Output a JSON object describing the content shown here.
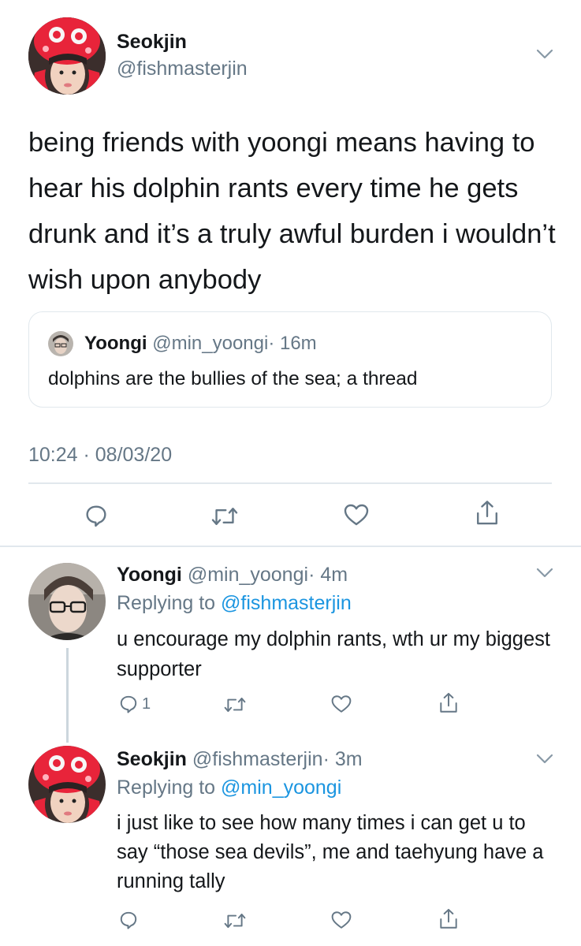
{
  "main_tweet": {
    "author_name": "Seokjin",
    "author_handle": "@fishmasterjin",
    "text": "being friends with yoongi means having to hear his dolphin rants every time he gets drunk and it’s a truly awful burden i wouldn’t wish upon anybody",
    "quoted": {
      "author_name": "Yoongi",
      "author_handle": "@min_yoongi",
      "age": "· 16m",
      "text": "dolphins are the bullies of the sea; a thread"
    },
    "timestamp": "10:24 · 08/03/20"
  },
  "replies": [
    {
      "author_name": "Yoongi",
      "author_handle": "@min_yoongi",
      "age": "· 4m",
      "replying_prefix": "Replying to",
      "replying_to": "@fishmasterjin",
      "text": "u encourage my dolphin rants, wth ur my biggest supporter",
      "reply_count": "1"
    },
    {
      "author_name": "Seokjin",
      "author_handle": "@fishmasterjin",
      "age": "· 3m",
      "replying_prefix": "Replying to",
      "replying_to": "@min_yoongi",
      "text": "i just like to see how many times i can get u to say “those sea devils”, me and taehyung have a running tally",
      "reply_count": ""
    }
  ],
  "icons": {
    "reply": "reply-icon",
    "retweet": "retweet-icon",
    "like": "heart-icon",
    "share": "share-icon",
    "menu": "chevron-down-icon"
  },
  "colors": {
    "link": "#1b95e0",
    "secondary": "#657786",
    "divider": "#e1e8ed",
    "thread_line": "#ccd6dd"
  }
}
